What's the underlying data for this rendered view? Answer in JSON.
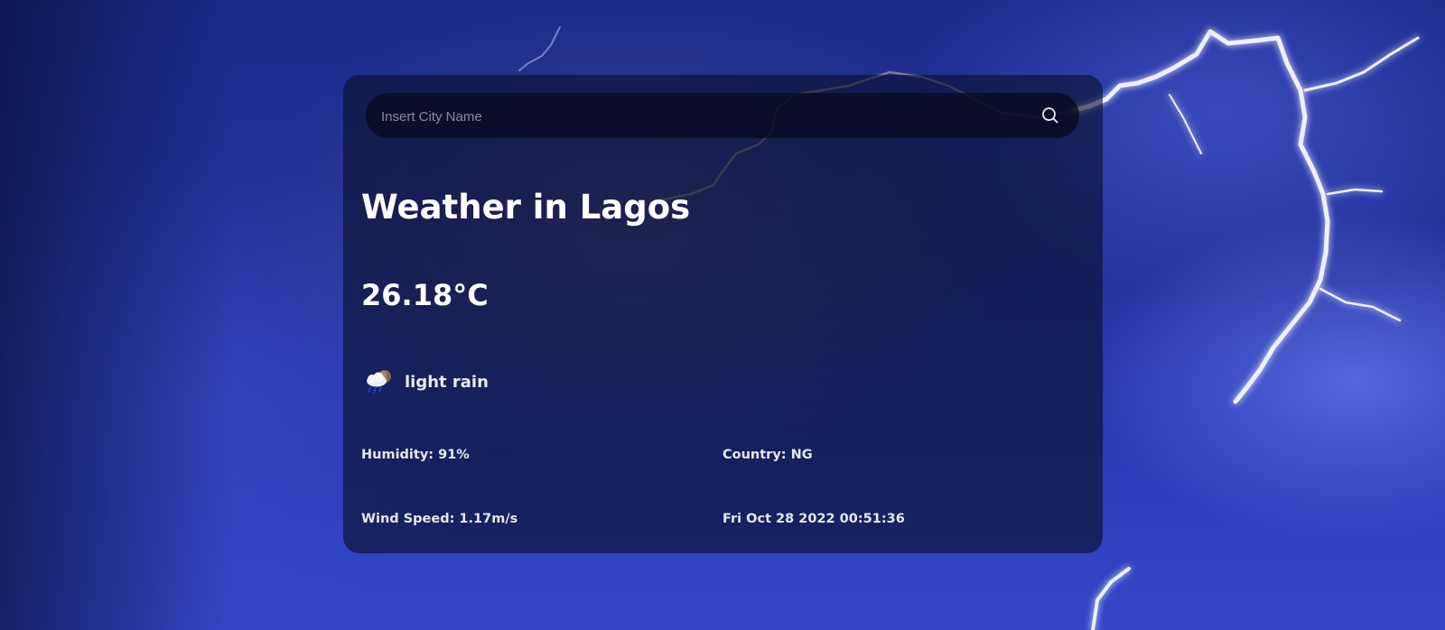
{
  "search": {
    "placeholder": "Insert City Name",
    "value": "",
    "button_icon": "search-icon"
  },
  "weather": {
    "title": "Weather in Lagos",
    "temperature": "26.18°C",
    "condition_icon": "rain-cloud-icon",
    "condition": "light rain",
    "humidity_label": "Humidity: 91%",
    "country_label": "Country: NG",
    "wind_label": "Wind Speed: 1.17m/s",
    "datetime": "Fri Oct 28 2022 00:51:36"
  },
  "theme": {
    "card_background": "#0a0e28",
    "text_color": "#ffffff",
    "background_accent": "#2a3db8"
  }
}
